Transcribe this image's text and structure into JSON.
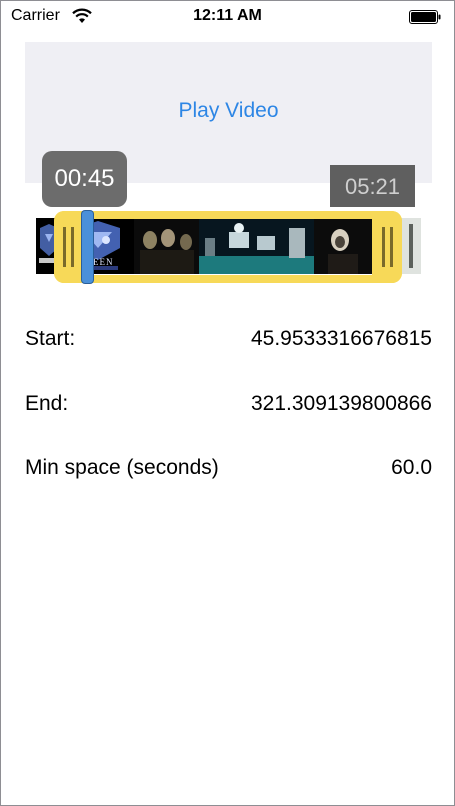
{
  "status_bar": {
    "carrier": "Carrier",
    "time": "12:11 AM"
  },
  "video": {
    "play_label": "Play Video"
  },
  "trimmer": {
    "start_time": "00:45",
    "end_time": "05:21",
    "accent_color": "#f7d958",
    "playhead_color": "#4a90d9",
    "thumbnail_text": "QUEEN"
  },
  "values": {
    "start_label": "Start:",
    "start_value": "45.9533316676815",
    "end_label": "End:",
    "end_value": "321.309139800866",
    "min_space_label": "Min space (seconds)",
    "min_space_value": "60.0"
  },
  "icons": [
    "wifi-icon",
    "battery-icon",
    "grip-icon"
  ]
}
